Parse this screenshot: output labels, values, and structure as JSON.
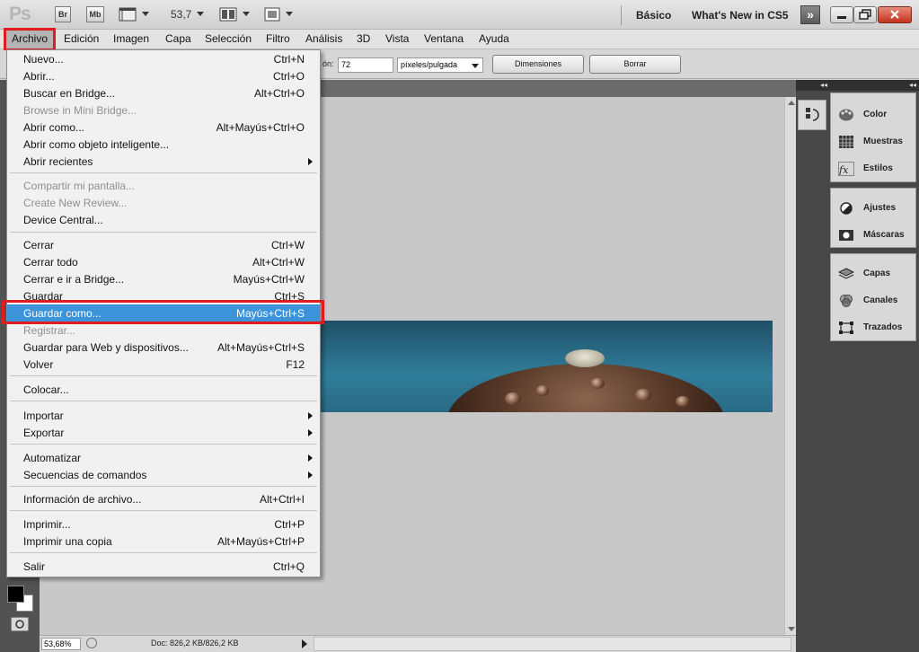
{
  "app": {
    "logo": "Ps",
    "bridge_btn": "Br",
    "minibridge_btn": "Mb",
    "zoom_value": "53,7",
    "workspace_active": "Básico",
    "workspace_new": "What's New in CS5",
    "workspace_more": "»"
  },
  "menubar": {
    "items": [
      "Archivo",
      "Edición",
      "Imagen",
      "Capa",
      "Selección",
      "Filtro",
      "Análisis",
      "3D",
      "Vista",
      "Ventana",
      "Ayuda"
    ]
  },
  "options": {
    "resolution_label": "ón:",
    "resolution_value": "72",
    "resolution_unit": "píxeles/pulgada",
    "dimensions_button": "Dimensiones",
    "clear_button": "Borrar"
  },
  "file_menu": {
    "items": [
      {
        "label": "Nuevo...",
        "shortcut": "Ctrl+N"
      },
      {
        "label": "Abrir...",
        "shortcut": "Ctrl+O"
      },
      {
        "label": "Buscar en Bridge...",
        "shortcut": "Alt+Ctrl+O"
      },
      {
        "label": "Browse in Mini Bridge...",
        "shortcut": ""
      },
      {
        "label": "Abrir como...",
        "shortcut": "Alt+Mayús+Ctrl+O"
      },
      {
        "label": "Abrir como objeto inteligente...",
        "shortcut": ""
      },
      {
        "label": "Abrir recientes",
        "shortcut": ""
      },
      {
        "label": "Compartir mi pantalla...",
        "shortcut": ""
      },
      {
        "label": "Create New Review...",
        "shortcut": ""
      },
      {
        "label": "Device Central...",
        "shortcut": ""
      },
      {
        "label": "Cerrar",
        "shortcut": "Ctrl+W"
      },
      {
        "label": "Cerrar todo",
        "shortcut": "Alt+Ctrl+W"
      },
      {
        "label": "Cerrar e ir a Bridge...",
        "shortcut": "Mayús+Ctrl+W"
      },
      {
        "label": "Guardar",
        "shortcut": "Ctrl+S"
      },
      {
        "label": "Guardar como...",
        "shortcut": "Mayús+Ctrl+S"
      },
      {
        "label": "Registrar...",
        "shortcut": ""
      },
      {
        "label": "Guardar para Web y dispositivos...",
        "shortcut": "Alt+Mayús+Ctrl+S"
      },
      {
        "label": "Volver",
        "shortcut": "F12"
      },
      {
        "label": "Colocar...",
        "shortcut": ""
      },
      {
        "label": "Importar",
        "shortcut": ""
      },
      {
        "label": "Exportar",
        "shortcut": ""
      },
      {
        "label": "Automatizar",
        "shortcut": ""
      },
      {
        "label": "Secuencias de comandos",
        "shortcut": ""
      },
      {
        "label": "Información de archivo...",
        "shortcut": "Alt+Ctrl+I"
      },
      {
        "label": "Imprimir...",
        "shortcut": "Ctrl+P"
      },
      {
        "label": "Imprimir una copia",
        "shortcut": "Alt+Mayús+Ctrl+P"
      },
      {
        "label": "Salir",
        "shortcut": "Ctrl+Q"
      }
    ]
  },
  "status": {
    "zoom": "53,68%",
    "doc_info": "Doc: 826,2 KB/826,2 KB"
  },
  "panels": {
    "group1": [
      "Color",
      "Muestras",
      "Estilos"
    ],
    "group2": [
      "Ajustes",
      "Máscaras"
    ],
    "group3": [
      "Capas",
      "Canales",
      "Trazados"
    ]
  },
  "colors": {
    "highlight": "#3d93d9",
    "annotation_red": "#e11b22"
  }
}
